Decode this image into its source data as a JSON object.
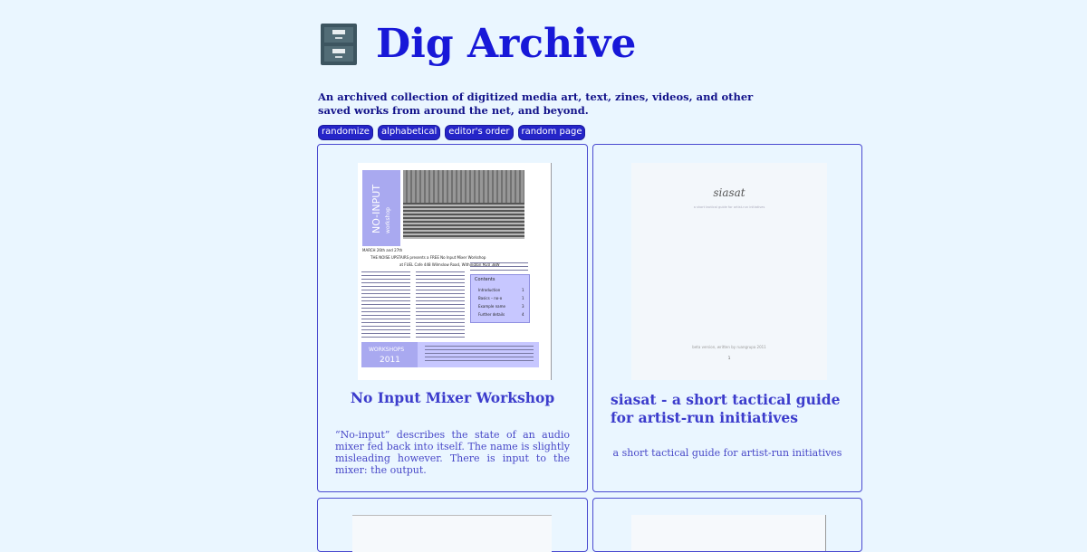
{
  "header": {
    "icon": "filing-cabinet-icon",
    "title": "Dig Archive",
    "intro": "An archived collection of digitized media art, text, zines, videos, and other saved works from around the net, and beyond."
  },
  "sort_buttons": [
    "randomize",
    "alphabetical",
    "editor's order",
    "random page"
  ],
  "cards": [
    {
      "title": "No Input Mixer Workshop",
      "description": "“No-input” describes the state of an audio mixer fed back into itself. The name is slightly misleading however. There is input to the mixer: the output.",
      "thumbnail": {
        "vertical_title": "NO-INPUT",
        "vertical_sub": "workshop",
        "dates": "MARCH 26th and 27th",
        "headline": "THE NOISE UPSTAIRS presents a FREE No Input Mixer Workshop",
        "venue": "at FUEL Cafe 448 Wilmslow Road, Withington M20 3BW",
        "contents_title": "Contents",
        "contents_items": [
          "Introduction",
          "Basics – no-o",
          "Example name",
          "Further details"
        ],
        "contents_pages": [
          "1",
          "1",
          "3",
          "4"
        ],
        "footer_label": "WORKSHOPS",
        "footer_year": "2011"
      }
    },
    {
      "title": "siasat - a short tactical guide for artist-run initiatives",
      "description": "a short tactical guide for artist-run initiatives",
      "thumbnail": {
        "doc_title": "siasat",
        "doc_subtitle": "a short tactical guide for artist-run initiatives",
        "doc_footer": "beta version, written by ruangrupa 2011",
        "page_number": "1"
      }
    }
  ],
  "colors": {
    "background": "#eaf6ff",
    "title": "#1818d8",
    "button": "#2525c8",
    "card_border": "#4a4ad0"
  }
}
